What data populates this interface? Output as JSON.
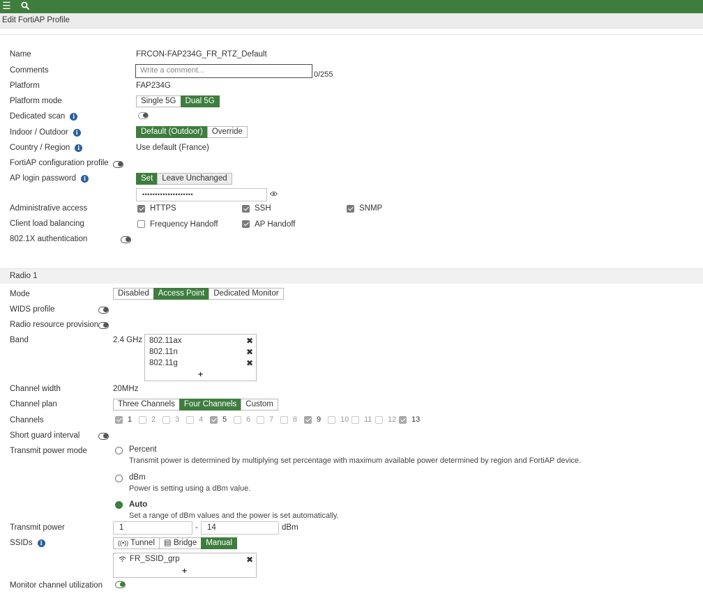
{
  "topbar": {
    "menu_icon": "hamburger-menu-icon",
    "search_icon": "search-icon"
  },
  "page": {
    "title": "Edit FortiAP Profile"
  },
  "form": {
    "name": {
      "label": "Name",
      "value": "FRCON-FAP234G_FR_RTZ_Default"
    },
    "comments": {
      "label": "Comments",
      "placeholder": "Write a comment...",
      "counter": "0/255"
    },
    "platform": {
      "label": "Platform",
      "value": "FAP234G"
    },
    "platform_mode": {
      "label": "Platform mode",
      "options": [
        "Single 5G",
        "Dual 5G"
      ],
      "selected": "Dual 5G"
    },
    "dedicated_scan": {
      "label": "Dedicated scan",
      "enabled": false
    },
    "indoor_outdoor": {
      "label": "Indoor / Outdoor",
      "options": [
        "Default (Outdoor)",
        "Override"
      ],
      "selected": "Default (Outdoor)"
    },
    "country_region": {
      "label": "Country / Region",
      "value": "Use default (France)"
    },
    "fortiap_config_profile": {
      "label": "FortiAP configuration profile",
      "enabled": false
    },
    "ap_login_password": {
      "label": "AP login password",
      "options": [
        "Set",
        "Leave Unchanged"
      ],
      "selected": "Set",
      "value": "••••••••••••••••••••"
    },
    "admin_access": {
      "label": "Administrative access",
      "items": [
        {
          "label": "HTTPS",
          "checked": true
        },
        {
          "label": "SSH",
          "checked": true
        },
        {
          "label": "SNMP",
          "checked": true
        }
      ]
    },
    "client_load_balancing": {
      "label": "Client load balancing",
      "items": [
        {
          "label": "Frequency Handoff",
          "checked": false
        },
        {
          "label": "AP Handoff",
          "checked": true
        }
      ]
    },
    "auth_8021x": {
      "label": "802.1X authentication",
      "enabled": false
    }
  },
  "radio1": {
    "heading": "Radio 1",
    "mode": {
      "label": "Mode",
      "options": [
        "Disabled",
        "Access Point",
        "Dedicated Monitor"
      ],
      "selected": "Access Point"
    },
    "wids_profile": {
      "label": "WIDS profile",
      "enabled": false
    },
    "rrp": {
      "label": "Radio resource provision",
      "enabled": false
    },
    "band": {
      "label": "Band",
      "freq": "2.4 GHz",
      "items": [
        "802.11ax",
        "802.11n",
        "802.11g"
      ],
      "add": "+"
    },
    "channel_width": {
      "label": "Channel width",
      "value": "20MHz"
    },
    "channel_plan": {
      "label": "Channel plan",
      "options": [
        "Three Channels",
        "Four Channels",
        "Custom"
      ],
      "selected": "Four Channels"
    },
    "channels": {
      "label": "Channels",
      "items": [
        {
          "num": "1",
          "checked": true
        },
        {
          "num": "2",
          "checked": false
        },
        {
          "num": "3",
          "checked": false
        },
        {
          "num": "4",
          "checked": false
        },
        {
          "num": "5",
          "checked": true
        },
        {
          "num": "6",
          "checked": false
        },
        {
          "num": "7",
          "checked": false
        },
        {
          "num": "8",
          "checked": false
        },
        {
          "num": "9",
          "checked": true
        },
        {
          "num": "10",
          "checked": false
        },
        {
          "num": "11",
          "checked": false
        },
        {
          "num": "12",
          "checked": false
        },
        {
          "num": "13",
          "checked": true
        }
      ]
    },
    "short_guard": {
      "label": "Short guard interval",
      "enabled": false
    },
    "tx_power_mode": {
      "label": "Transmit power mode",
      "selected": "Auto",
      "options": [
        {
          "title": "Percent",
          "desc": "Transmit power is determined by multiplying set percentage with maximum available power determined by region and FortiAP device."
        },
        {
          "title": "dBm",
          "desc": "Power is setting using a dBm value."
        },
        {
          "title": "Auto",
          "desc": "Set a range of dBm values and the power is set automatically."
        }
      ]
    },
    "tx_power": {
      "label": "Transmit power",
      "min": "1",
      "sep": "-",
      "max": "14",
      "unit": "dBm"
    },
    "ssids": {
      "label": "SSIDs",
      "options": [
        "Tunnel",
        "Bridge",
        "Manual"
      ],
      "selected": "Manual",
      "items": [
        "FR_SSID_grp"
      ],
      "add": "+"
    },
    "monitor_channel": {
      "label": "Monitor channel utilization",
      "enabled": true
    }
  }
}
